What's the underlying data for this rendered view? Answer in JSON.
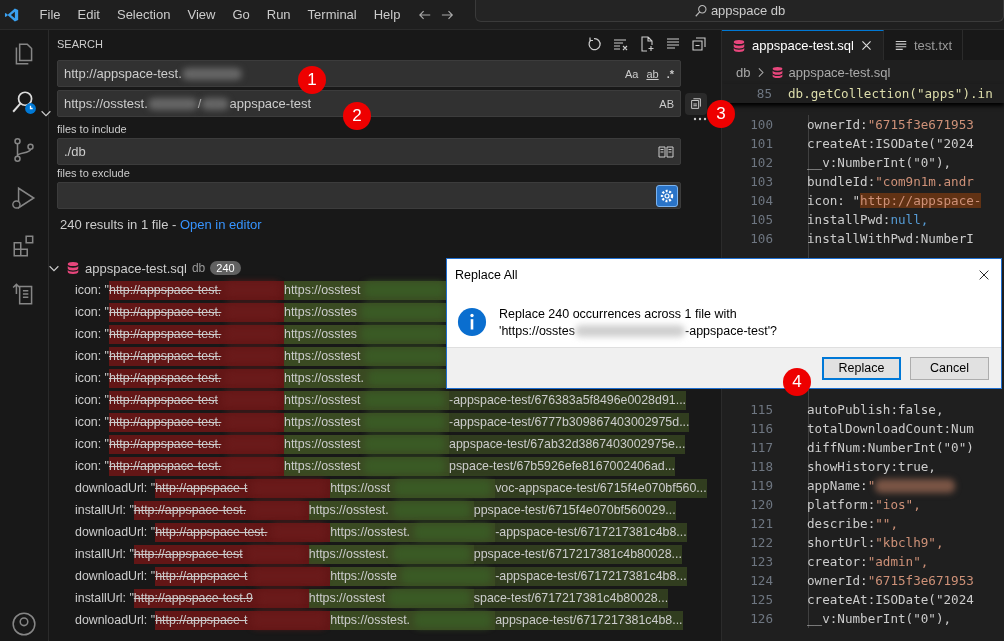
{
  "menu_bar": {
    "items": [
      "File",
      "Edit",
      "Selection",
      "View",
      "Go",
      "Run",
      "Terminal",
      "Help"
    ],
    "command_center": "appspace db"
  },
  "activity_bar": {
    "items": [
      {
        "kind": "files",
        "selected": false
      },
      {
        "kind": "search",
        "selected": true
      },
      {
        "kind": "source-control",
        "selected": false
      },
      {
        "kind": "run",
        "selected": false
      },
      {
        "kind": "extensions",
        "selected": false
      },
      {
        "kind": "remote",
        "selected": false
      },
      {
        "kind": "account",
        "selected": false
      }
    ]
  },
  "search": {
    "title": "SEARCH",
    "find_value": "http://appspace-test.",
    "find_options": [
      "Aa",
      "ab",
      ".*"
    ],
    "replace_value_start": "https://osstest.",
    "replace_value_mid": "/",
    "replace_value_end": "appspace-test",
    "replace_options": [
      "AB"
    ],
    "include_label": "files to include",
    "include_value": "./db",
    "exclude_label": "files to exclude",
    "summary": "240 results in 1 file - ",
    "open_link": "Open in editor"
  },
  "file": {
    "name": "appspace-test.sql",
    "folder": "db",
    "count": "240",
    "expanded": true
  },
  "results": [
    {
      "prefix": "icon: \"",
      "removed": "http://appspace-test.",
      "added": "https://osstest"
    },
    {
      "prefix": "icon: \"",
      "removed": "http://appspace-test.",
      "added": "https://osstes"
    },
    {
      "prefix": "icon: \"",
      "removed": "http://appspace-test.",
      "added": "https://osstes"
    },
    {
      "prefix": "icon: \"",
      "removed": "http://appspace-test.",
      "added": "https://osstest"
    },
    {
      "prefix": "icon: \"",
      "removed": "http://appspace-test.",
      "added": "https://osstest."
    },
    {
      "prefix": "icon: \"",
      "removed": "http://appspace-test",
      "added": "https://osstest",
      "rest": "-appspace-test/676383a5f8496e0028d91..."
    },
    {
      "prefix": "icon: \"",
      "removed": "http://appspace-test.",
      "added": "https://osstest",
      "rest": "-appspace-test/6777b309867403002975d..."
    },
    {
      "prefix": "icon: \"",
      "removed": "http://appspace-test.",
      "added": "https://osstest",
      "rest": "appspace-test/67ab32d3867403002975e..."
    },
    {
      "prefix": "icon: \"",
      "removed": "http://appspace-test.",
      "added": "https://osstest",
      "rest": "pspace-test/67b5926efe8167002406ad..."
    },
    {
      "prefix": "downloadUrl: \"",
      "removed": "http://appspace-t",
      "added": "https://osst",
      "rest": "voc-appspace-test/6715f4e070bf560..."
    },
    {
      "prefix": "installUrl: \"",
      "removed": "http://appspace-test.",
      "added": "https://osstest.",
      "rest": "ppspace-test/6715f4e070bf560029..."
    },
    {
      "prefix": "downloadUrl: \"",
      "removed": "http://appspace-test.",
      "added": "https://osstest.",
      "rest": "-appspace-test/6717217381c4b8..."
    },
    {
      "prefix": "installUrl: \"",
      "removed": "http://appspace-test",
      "added": "https://osstest.",
      "rest": "ppspace-test/6717217381c4b80028..."
    },
    {
      "prefix": "downloadUrl: \"",
      "removed": "http://appspace-t",
      "added": "https://osste",
      "rest": "-appspace-test/6717217381c4b8..."
    },
    {
      "prefix": "installUrl: \"",
      "removed": "http://appspace-test.9",
      "added": "https://osstest",
      "rest": "space-test/6717217381c4b80028..."
    },
    {
      "prefix": "downloadUrl: \"",
      "removed": "http://appspace-t",
      "added": "https://osstest.",
      "rest": "appspace-test/6717217381c4b8..."
    }
  ],
  "editor": {
    "tabs": [
      {
        "label": "appspace-test.sql",
        "kind": "sql",
        "selected": true
      },
      {
        "label": "test.txt",
        "kind": "text",
        "selected": false
      }
    ],
    "breadcrumb": [
      "db",
      "appspace-test.sql"
    ],
    "sticky": {
      "no": "85",
      "code": "db.getCollection(\"apps\").in"
    },
    "lines": [
      {
        "no": "100",
        "key": "ownerId: ",
        "value": "\"6715f3e671953",
        "kind": "string"
      },
      {
        "no": "101",
        "key": "createAt: ",
        "value": "ISODate(\"2024",
        "kind": "call"
      },
      {
        "no": "102",
        "key": "__v: ",
        "value": "NumberInt(\"0\"),",
        "kind": "call"
      },
      {
        "no": "103",
        "key": "bundleId: ",
        "value": "\"com9n1m.andr",
        "kind": "string"
      },
      {
        "no": "104",
        "key": "icon: \"",
        "value": "http://appspace-",
        "kind": "match"
      },
      {
        "no": "105",
        "key": "installPwd: ",
        "value": "null,",
        "kind": "keyword"
      },
      {
        "no": "106",
        "key": "installWithPwd: ",
        "value": "NumberI",
        "kind": "plain"
      },
      {
        "no": "115",
        "key": "autoPublish: ",
        "value": "false,",
        "kind": "plain"
      },
      {
        "no": "116",
        "key": "totalDownloadCount: ",
        "value": "Num",
        "kind": "plain"
      },
      {
        "no": "117",
        "key": "diffNum: ",
        "value": "NumberInt(\"0\")",
        "kind": "call"
      },
      {
        "no": "118",
        "key": "showHistory: ",
        "value": "true,",
        "kind": "plain"
      },
      {
        "no": "119",
        "key": "appName: ",
        "value": "\"",
        "kind": "redacted"
      },
      {
        "no": "120",
        "key": "platform: ",
        "value": "\"ios\",",
        "kind": "string"
      },
      {
        "no": "121",
        "key": "describe: ",
        "value": "\"\",",
        "kind": "string"
      },
      {
        "no": "122",
        "key": "shortUrl: ",
        "value": "\"kbclh9\",",
        "kind": "string"
      },
      {
        "no": "123",
        "key": "creator: ",
        "value": "\"admin\",",
        "kind": "string"
      },
      {
        "no": "124",
        "key": "ownerId: ",
        "value": "\"6715f3e671953",
        "kind": "string"
      },
      {
        "no": "125",
        "key": "createAt: ",
        "value": "ISODate(\"2024",
        "kind": "call"
      },
      {
        "no": "126",
        "key": "__v: ",
        "value": "NumberInt(\"0\"),",
        "kind": "call"
      }
    ]
  },
  "dialog": {
    "title": "Replace All",
    "message_line1": "Replace 240 occurrences across 1 file with",
    "message_start": "'https://osstes",
    "message_end": "-appspace-test'?",
    "buttons": [
      {
        "label": "Replace",
        "selected": true
      },
      {
        "label": "Cancel",
        "selected": false
      }
    ]
  },
  "markers": [
    "1",
    "2",
    "3",
    "4"
  ]
}
